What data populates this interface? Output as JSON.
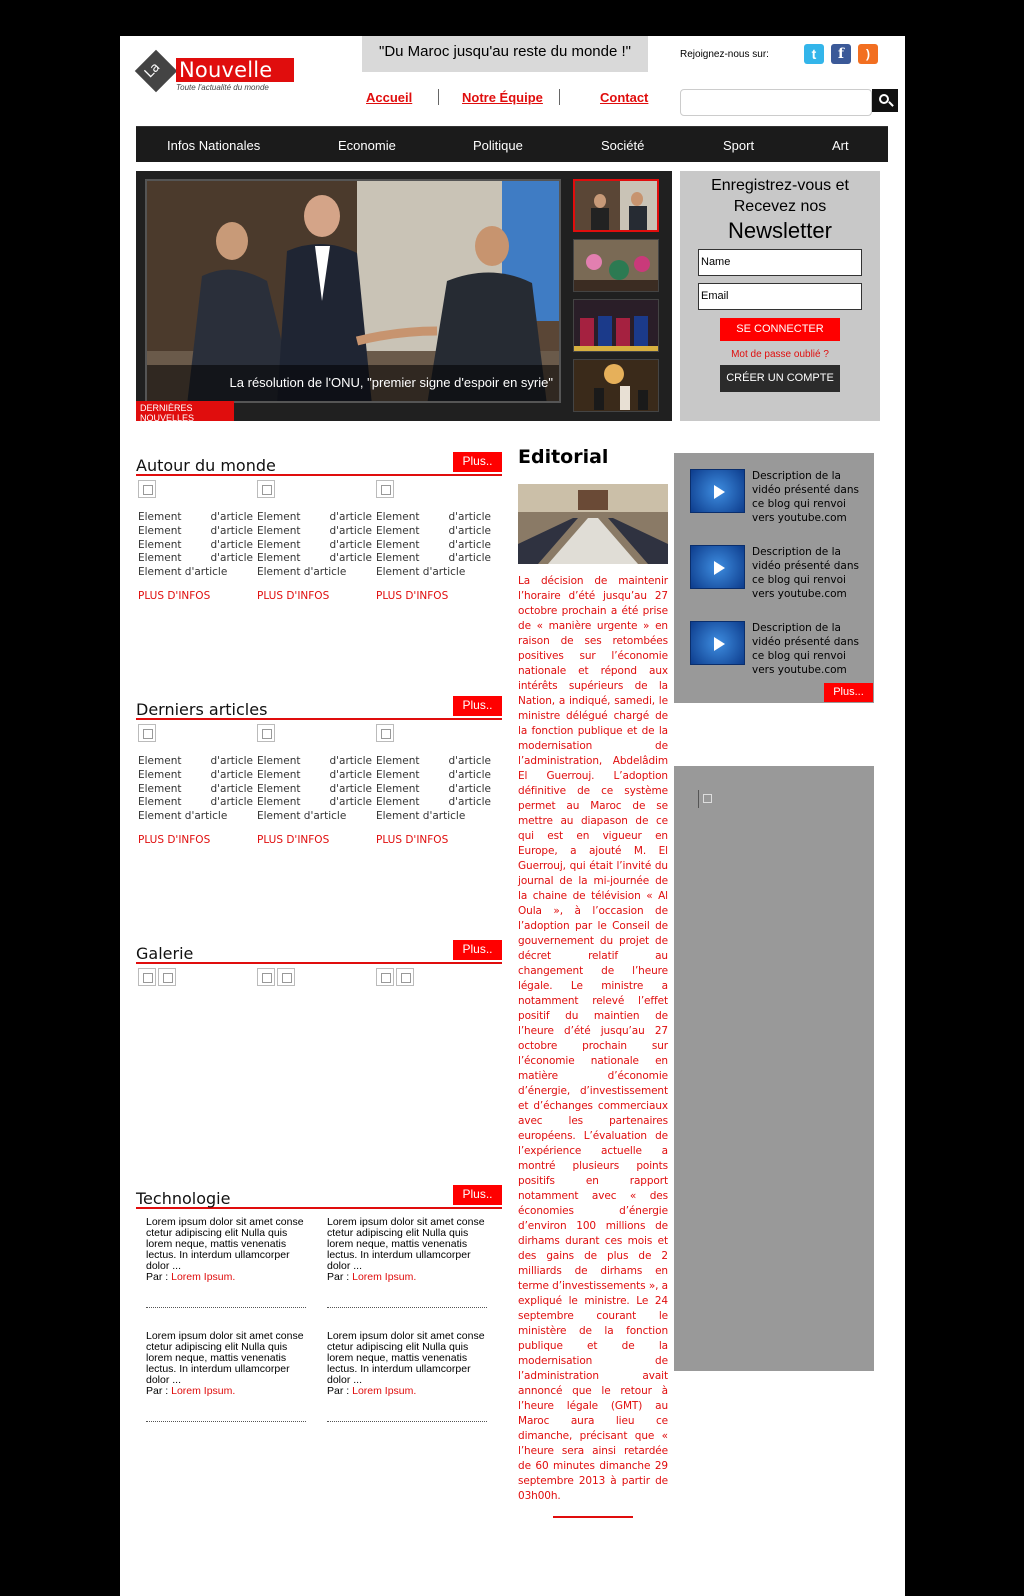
{
  "header": {
    "logo_la": "La",
    "logo_name": "Nouvelle",
    "logo_tagline": "Toute l'actualité du monde",
    "motto": "\"Du Maroc jusqu'au reste du monde !\"",
    "join_label": "Rejoignez-nous sur:",
    "social": [
      {
        "icon": "twitter-icon",
        "glyph": "t"
      },
      {
        "icon": "facebook-icon",
        "glyph": "f"
      },
      {
        "icon": "rss-icon",
        "glyph": ")"
      }
    ],
    "links": [
      "Accueil",
      "Notre Équipe",
      "Contact"
    ],
    "search_placeholder": ""
  },
  "nav": [
    "Infos Nationales",
    "Economie",
    "Politique",
    "Société",
    "Sport",
    "Art"
  ],
  "slider": {
    "caption": "La résolution de l'ONU, \"premier signe d'espoir en syrie\"",
    "badge": "DERNIÈRES NOUVELLES"
  },
  "newsletter": {
    "title_line1": "Enregistrez-vous et",
    "title_line2": "Recevez nos",
    "title_big": "Newsletter",
    "name_placeholder": "Name",
    "email_placeholder": "Email",
    "connect_label": "SE CONNECTER",
    "forgot_label": "Mot de passe oublié ?",
    "create_label": "CRÉER UN COMPTE"
  },
  "sections": {
    "plus_label": "Plus..",
    "autour": {
      "title": "Autour du monde"
    },
    "derniers": {
      "title": "Derniers articles"
    },
    "galerie": {
      "title": "Galerie"
    },
    "technologie": {
      "title": "Technologie"
    },
    "element_word1": "Element",
    "element_word2": "d'article",
    "element_full": "Element d'article",
    "more_label": "PLUS D'INFOS"
  },
  "tech_items": [
    {
      "text": "Lorem ipsum dolor sit amet conse ctetur adipiscing elit Nulla quis lorem neque, mattis venenatis lectus. In interdum ullamcorper dolor ...",
      "author_prefix": "Par :",
      "author": "Lorem Ipsum."
    },
    {
      "text": "Lorem ipsum dolor sit amet conse ctetur adipiscing elit Nulla quis lorem neque, mattis venenatis lectus. In interdum ullamcorper dolor ...",
      "author_prefix": "Par :",
      "author": "Lorem Ipsum."
    },
    {
      "text": "Lorem ipsum dolor sit amet conse ctetur adipiscing elit Nulla quis lorem neque, mattis venenatis lectus. In interdum ullamcorper dolor ...",
      "author_prefix": "Par :",
      "author": "Lorem Ipsum."
    },
    {
      "text": "Lorem ipsum dolor sit amet conse ctetur adipiscing elit Nulla quis lorem neque, mattis venenatis lectus. In interdum ullamcorper dolor ...",
      "author_prefix": "Par :",
      "author": "Lorem Ipsum."
    }
  ],
  "editorial": {
    "title": "Editorial",
    "text": "La décision de maintenir l’horaire d’été jusqu’au 27 octobre prochain a été prise de « manière urgente » en raison de ses retombées positives sur l’économie nationale et répond aux intérêts supérieurs de la Nation, a indiqué, samedi, le ministre délégué chargé de la fonction publique et de la modernisation de l’administration, Abdelâdim El Guerrouj. L’adoption définitive de ce système permet au Maroc de se mettre au diapason de ce qui est en vigueur en Europe, a ajouté M. El Guerrouj, qui était l’invité du journal de la mi-journée de la chaine de télévision « Al Oula », à l’occasion de l’adoption par le Conseil de gouvernement du projet de décret relatif au changement de l’heure légale. Le ministre a notamment relevé l’effet positif du maintien de l’heure d’été jusqu’au 27 octobre prochain sur l’économie nationale en matière d’économie d’énergie, d’investissement et d’échanges commerciaux avec les partenaires européens. L’évaluation de l’expérience actuelle a montré plusieurs points positifs en rapport notamment avec « des économies d’énergie d’environ 100 millions de dirhams durant ces mois et des gains de plus de 2 milliards de dirhams en terme d’investissements », a expliqué le ministre. Le 24 septembre courant le ministère de la fonction publique et de la modernisation de l’administration avait annoncé que le retour à l’heure légale (GMT) au Maroc aura lieu ce dimanche, précisant que « l’heure sera ainsi retardée de 60 minutes dimanche 29 septembre 2013 à partir de 03h00h."
  },
  "videos": {
    "items": [
      {
        "desc": "Description de la vidéo présenté dans ce blog qui renvoi vers youtube.com"
      },
      {
        "desc": "Description de la vidéo présenté dans ce blog qui renvoi vers youtube.com"
      },
      {
        "desc": "Description de la vidéo présenté dans ce blog qui renvoi vers youtube.com"
      }
    ],
    "plus_label": "Plus..."
  },
  "colors": {
    "accent": "#e00d0d",
    "nav_bg": "#1b1b1b",
    "panel_grey": "#999999"
  }
}
